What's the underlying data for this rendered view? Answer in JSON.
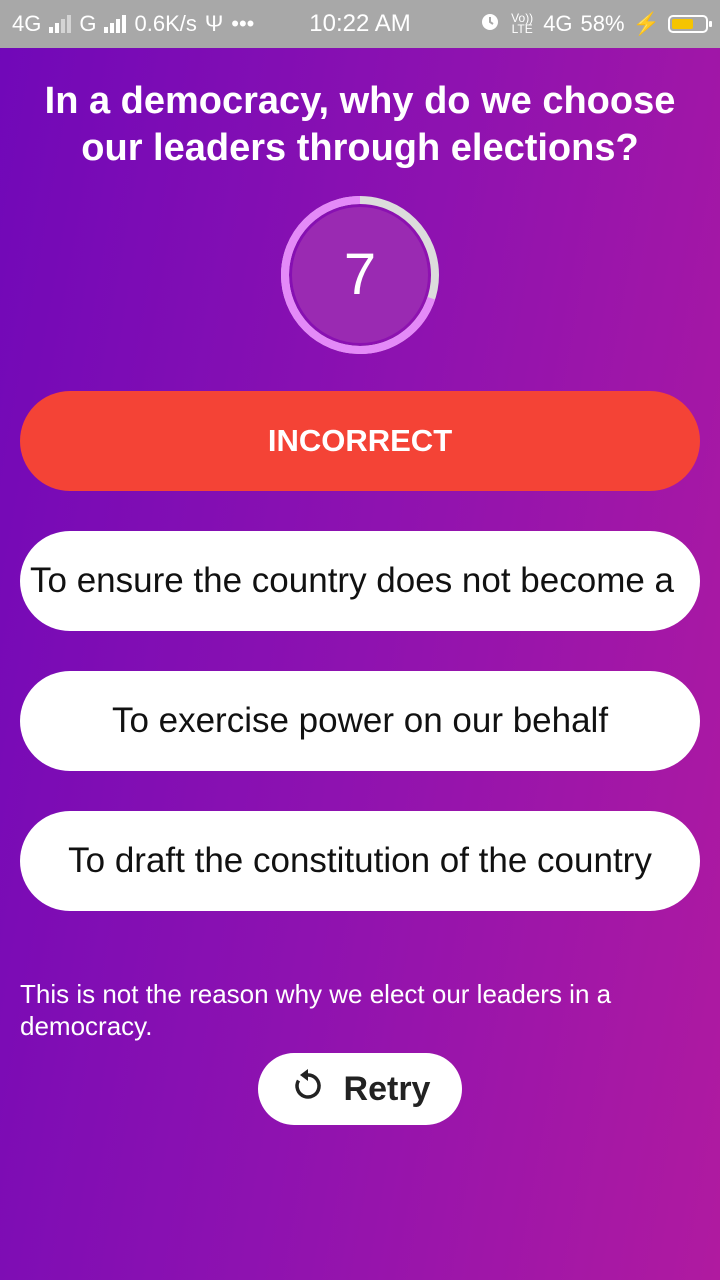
{
  "status_bar": {
    "network1": "4G",
    "network2": "G",
    "speed": "0.6K/s",
    "more": "•••",
    "time": "10:22 AM",
    "volte": "Vo)) LTE",
    "network3": "4G",
    "battery": "58%",
    "battery_color": "#f5c400"
  },
  "quiz": {
    "question": "In a democracy, why do we choose our leaders through elections?",
    "timer_value": "7",
    "timer_remaining_fraction": 0.7,
    "result_label": "INCORRECT",
    "options": [
      "To ensure the country does not become a",
      "To exercise power on our behalf",
      "To draft the constitution of the country"
    ],
    "feedback": "This is not the reason why we elect our leaders in a democracy.",
    "retry_label": "Retry"
  },
  "colors": {
    "incorrect": "#f44336",
    "timer_ring": "#e48af8",
    "timer_track": "#dcdcdc"
  }
}
